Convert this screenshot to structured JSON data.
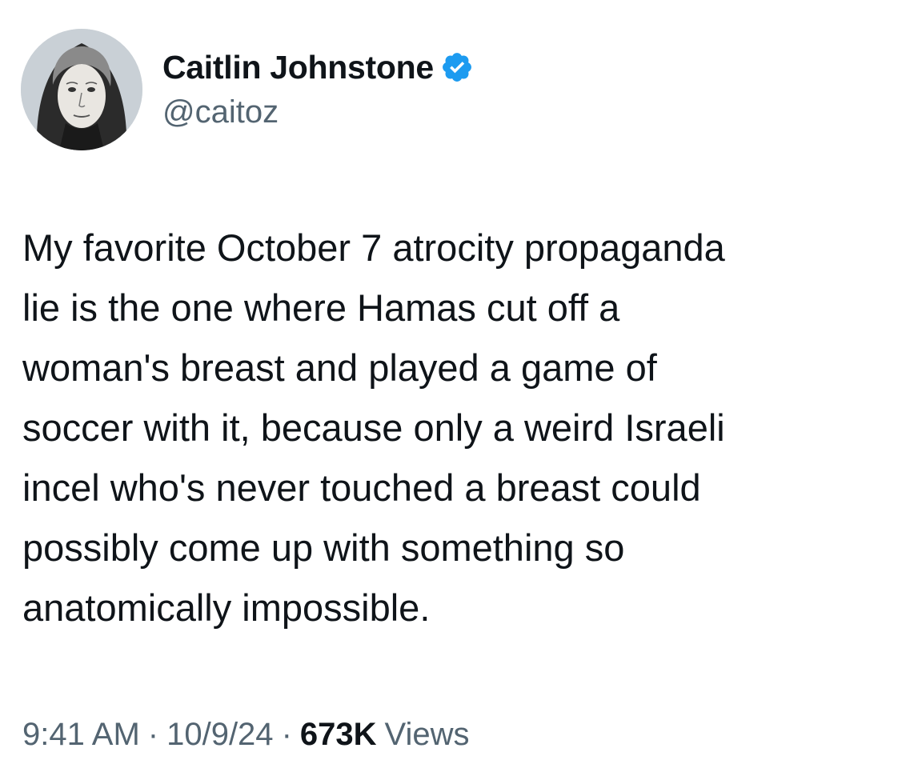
{
  "author": {
    "display_name": "Caitlin Johnstone",
    "handle": "@caitoz",
    "verified_icon": "verified-badge-icon",
    "verified_color": "#1d9bf0"
  },
  "tweet": {
    "text": "My favorite October 7 atrocity propaganda\nlie is the one where Hamas cut off a\nwoman's breast and played a game of\nsoccer with it, because only a weird Israeli\nincel who's never touched a breast could\npossibly come up with something so\nanatomically impossible."
  },
  "meta": {
    "time": "9:41 AM",
    "separator": "·",
    "date": "10/9/24",
    "views_count": "673K",
    "views_label": "Views"
  },
  "colors": {
    "text_primary": "#0f1419",
    "text_secondary": "#536471",
    "background": "#ffffff"
  }
}
